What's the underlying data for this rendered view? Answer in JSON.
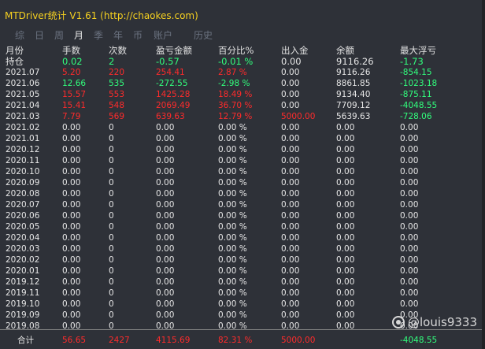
{
  "title": "MTDriver统计 V1.61  (http://chaokes.com)",
  "tabs": [
    "综",
    "日",
    "周",
    "月",
    "季",
    "年",
    "币",
    "账户",
    "历史"
  ],
  "active_tab": 3,
  "columns": [
    "月份",
    "手数",
    "次数",
    "盈亏金额",
    "百分比%",
    "出入金",
    "余额",
    "最大浮亏"
  ],
  "rows": [
    [
      "持仓",
      "0.02",
      "2",
      "-0.57",
      "-0.01 %",
      "0.00",
      "9116.26",
      "-1.73"
    ],
    [
      "2021.07",
      "5.20",
      "220",
      "254.41",
      "2.87 %",
      "0.00",
      "9116.26",
      "-854.15"
    ],
    [
      "2021.06",
      "12.66",
      "535",
      "-272.55",
      "-2.98 %",
      "0.00",
      "8861.85",
      "-1023.18"
    ],
    [
      "2021.05",
      "15.57",
      "553",
      "1425.28",
      "18.49 %",
      "0.00",
      "9134.40",
      "-875.11"
    ],
    [
      "2021.04",
      "15.41",
      "548",
      "2069.49",
      "36.70 %",
      "0.00",
      "7709.12",
      "-4048.55"
    ],
    [
      "2021.03",
      "7.79",
      "569",
      "639.63",
      "12.79 %",
      "5000.00",
      "5639.63",
      "-728.06"
    ],
    [
      "2021.02",
      "0.00",
      "0",
      "0.00",
      "0.00 %",
      "0.00",
      "0.00",
      "0.00"
    ],
    [
      "2021.01",
      "0.00",
      "0",
      "0.00",
      "0.00 %",
      "0.00",
      "0.00",
      "0.00"
    ],
    [
      "2020.12",
      "0.00",
      "0",
      "0.00",
      "0.00 %",
      "0.00",
      "0.00",
      "0.00"
    ],
    [
      "2020.11",
      "0.00",
      "0",
      "0.00",
      "0.00 %",
      "0.00",
      "0.00",
      "0.00"
    ],
    [
      "2020.10",
      "0.00",
      "0",
      "0.00",
      "0.00 %",
      "0.00",
      "0.00",
      "0.00"
    ],
    [
      "2020.09",
      "0.00",
      "0",
      "0.00",
      "0.00 %",
      "0.00",
      "0.00",
      "0.00"
    ],
    [
      "2020.08",
      "0.00",
      "0",
      "0.00",
      "0.00 %",
      "0.00",
      "0.00",
      "0.00"
    ],
    [
      "2020.07",
      "0.00",
      "0",
      "0.00",
      "0.00 %",
      "0.00",
      "0.00",
      "0.00"
    ],
    [
      "2020.06",
      "0.00",
      "0",
      "0.00",
      "0.00 %",
      "0.00",
      "0.00",
      "0.00"
    ],
    [
      "2020.05",
      "0.00",
      "0",
      "0.00",
      "0.00 %",
      "0.00",
      "0.00",
      "0.00"
    ],
    [
      "2020.04",
      "0.00",
      "0",
      "0.00",
      "0.00 %",
      "0.00",
      "0.00",
      "0.00"
    ],
    [
      "2020.03",
      "0.00",
      "0",
      "0.00",
      "0.00 %",
      "0.00",
      "0.00",
      "0.00"
    ],
    [
      "2020.02",
      "0.00",
      "0",
      "0.00",
      "0.00 %",
      "0.00",
      "0.00",
      "0.00"
    ],
    [
      "2020.01",
      "0.00",
      "0",
      "0.00",
      "0.00 %",
      "0.00",
      "0.00",
      "0.00"
    ],
    [
      "2019.12",
      "0.00",
      "0",
      "0.00",
      "0.00 %",
      "0.00",
      "0.00",
      "0.00"
    ],
    [
      "2019.11",
      "0.00",
      "0",
      "0.00",
      "0.00 %",
      "0.00",
      "0.00",
      "0.00"
    ],
    [
      "2019.10",
      "0.00",
      "0",
      "0.00",
      "0.00 %",
      "0.00",
      "0.00",
      "0.00"
    ],
    [
      "2019.09",
      "0.00",
      "0",
      "0.00",
      "0.00 %",
      "0.00",
      "0.00",
      "0.00"
    ],
    [
      "2019.08",
      "0.00",
      "0",
      "0.00",
      "0.00 %",
      "0.00",
      "0.00",
      "0.00"
    ]
  ],
  "row_colors": [
    [
      "white",
      "green",
      "green",
      "green",
      "green",
      "white",
      "white",
      "green"
    ],
    [
      "white",
      "red",
      "red",
      "red",
      "red",
      "white",
      "white",
      "green"
    ],
    [
      "white",
      "green",
      "green",
      "green",
      "green",
      "white",
      "white",
      "green"
    ],
    [
      "white",
      "red",
      "red",
      "red",
      "red",
      "white",
      "white",
      "green"
    ],
    [
      "white",
      "red",
      "red",
      "red",
      "red",
      "white",
      "white",
      "green"
    ],
    [
      "white",
      "red",
      "red",
      "red",
      "red",
      "red",
      "white",
      "green"
    ]
  ],
  "footer": [
    "合计",
    "56.65",
    "2427",
    "4115.69",
    "82.31 %",
    "5000.00",
    "",
    "-4048.55"
  ],
  "footer_colors": [
    "white",
    "red",
    "red",
    "red",
    "red",
    "red",
    "white",
    "green"
  ],
  "watermark": "@louis9333",
  "colors": {
    "background": "#2e3138",
    "title": "#f5d020",
    "green": "#31ff7d",
    "red": "#ff2b2b",
    "white": "#e6e6e6",
    "tab_inactive": "#6b7280"
  }
}
